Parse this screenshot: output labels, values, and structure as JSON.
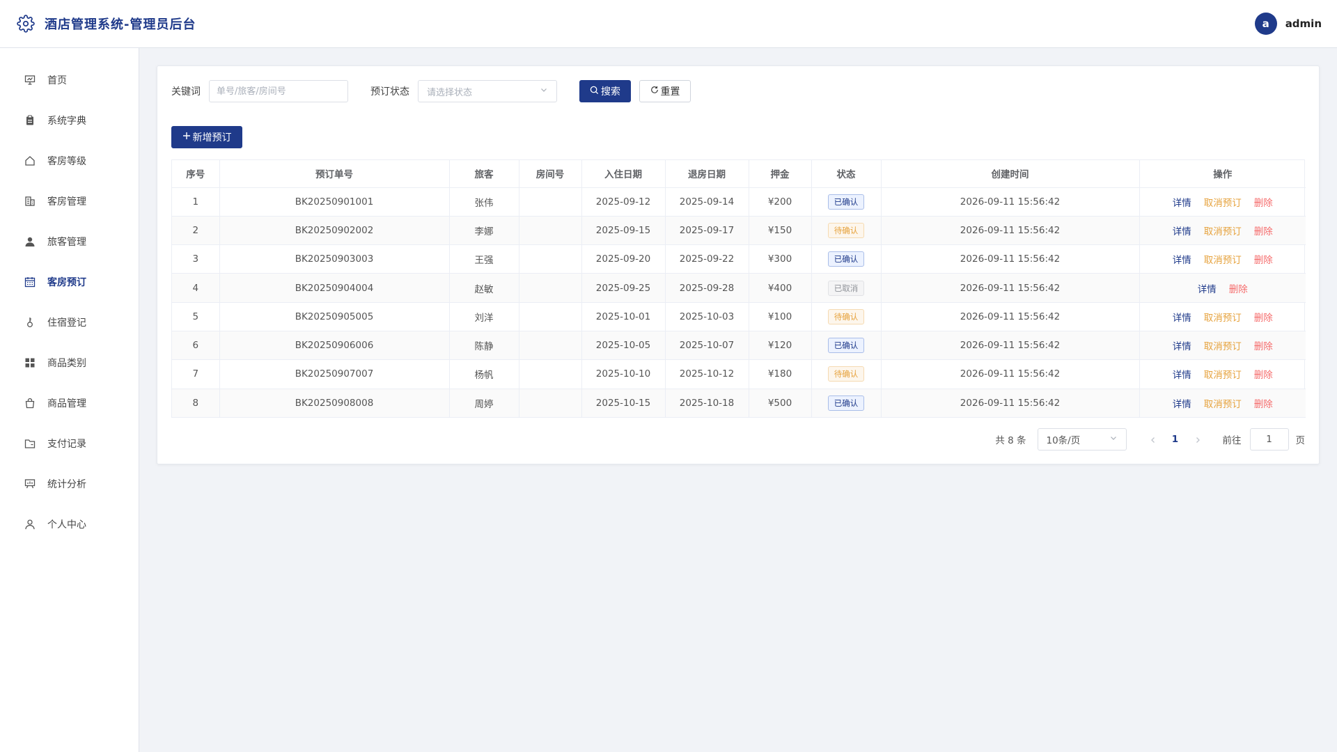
{
  "header": {
    "title": "酒店管理系统-管理员后台",
    "avatar_letter": "a",
    "username": "admin"
  },
  "sidebar": {
    "items": [
      {
        "label": "首页",
        "icon": "presentation-icon"
      },
      {
        "label": "系统字典",
        "icon": "clipboard-icon"
      },
      {
        "label": "客房等级",
        "icon": "home-icon"
      },
      {
        "label": "客房管理",
        "icon": "building-icon"
      },
      {
        "label": "旅客管理",
        "icon": "user-filled-icon"
      },
      {
        "label": "客房预订",
        "icon": "calendar-icon"
      },
      {
        "label": "住宿登记",
        "icon": "key-icon"
      },
      {
        "label": "商品类别",
        "icon": "grid-icon"
      },
      {
        "label": "商品管理",
        "icon": "bag-icon"
      },
      {
        "label": "支付记录",
        "icon": "folder-icon"
      },
      {
        "label": "统计分析",
        "icon": "chart-board-icon"
      },
      {
        "label": "个人中心",
        "icon": "user-icon"
      }
    ],
    "active_index": 5
  },
  "filters": {
    "keyword_label": "关键词",
    "keyword_placeholder": "单号/旅客/房间号",
    "keyword_value": "",
    "status_label": "预订状态",
    "status_placeholder": "请选择状态",
    "search_label": "搜索",
    "reset_label": "重置"
  },
  "add_button_label": "新增预订",
  "table": {
    "columns": [
      "序号",
      "预订单号",
      "旅客",
      "房间号",
      "入住日期",
      "退房日期",
      "押金",
      "状态",
      "创建时间",
      "操作"
    ],
    "rows": [
      {
        "index": "1",
        "order_no": "BK20250901001",
        "guest": "张伟",
        "room": "",
        "checkin": "2025-09-12",
        "checkout": "2025-09-14",
        "deposit": "¥200",
        "status": "已确认",
        "status_type": "confirmed",
        "created": "2026-09-11 15:56:42",
        "actions": [
          "详情",
          "取消预订",
          "删除"
        ]
      },
      {
        "index": "2",
        "order_no": "BK20250902002",
        "guest": "李娜",
        "room": "",
        "checkin": "2025-09-15",
        "checkout": "2025-09-17",
        "deposit": "¥150",
        "status": "待确认",
        "status_type": "pending",
        "created": "2026-09-11 15:56:42",
        "actions": [
          "详情",
          "取消预订",
          "删除"
        ]
      },
      {
        "index": "3",
        "order_no": "BK20250903003",
        "guest": "王强",
        "room": "",
        "checkin": "2025-09-20",
        "checkout": "2025-09-22",
        "deposit": "¥300",
        "status": "已确认",
        "status_type": "confirmed",
        "created": "2026-09-11 15:56:42",
        "actions": [
          "详情",
          "取消预订",
          "删除"
        ]
      },
      {
        "index": "4",
        "order_no": "BK20250904004",
        "guest": "赵敏",
        "room": "",
        "checkin": "2025-09-25",
        "checkout": "2025-09-28",
        "deposit": "¥400",
        "status": "已取消",
        "status_type": "cancelled",
        "created": "2026-09-11 15:56:42",
        "actions": [
          "详情",
          "删除"
        ]
      },
      {
        "index": "5",
        "order_no": "BK20250905005",
        "guest": "刘洋",
        "room": "",
        "checkin": "2025-10-01",
        "checkout": "2025-10-03",
        "deposit": "¥100",
        "status": "待确认",
        "status_type": "pending",
        "created": "2026-09-11 15:56:42",
        "actions": [
          "详情",
          "取消预订",
          "删除"
        ]
      },
      {
        "index": "6",
        "order_no": "BK20250906006",
        "guest": "陈静",
        "room": "",
        "checkin": "2025-10-05",
        "checkout": "2025-10-07",
        "deposit": "¥120",
        "status": "已确认",
        "status_type": "confirmed",
        "created": "2026-09-11 15:56:42",
        "actions": [
          "详情",
          "取消预订",
          "删除"
        ]
      },
      {
        "index": "7",
        "order_no": "BK20250907007",
        "guest": "杨帆",
        "room": "",
        "checkin": "2025-10-10",
        "checkout": "2025-10-12",
        "deposit": "¥180",
        "status": "待确认",
        "status_type": "pending",
        "created": "2026-09-11 15:56:42",
        "actions": [
          "详情",
          "取消预订",
          "删除"
        ]
      },
      {
        "index": "8",
        "order_no": "BK20250908008",
        "guest": "周婷",
        "room": "",
        "checkin": "2025-10-15",
        "checkout": "2025-10-18",
        "deposit": "¥500",
        "status": "已确认",
        "status_type": "confirmed",
        "created": "2026-09-11 15:56:42",
        "actions": [
          "详情",
          "取消预订",
          "删除"
        ]
      }
    ]
  },
  "pagination": {
    "total_text": "共 8 条",
    "page_size": "10条/页",
    "current_page": "1",
    "goto_label": "前往",
    "goto_value": "1",
    "page_suffix": "页"
  },
  "colors": {
    "primary": "#1f3a8a",
    "warning": "#e6a23c",
    "danger": "#f56c6c"
  }
}
